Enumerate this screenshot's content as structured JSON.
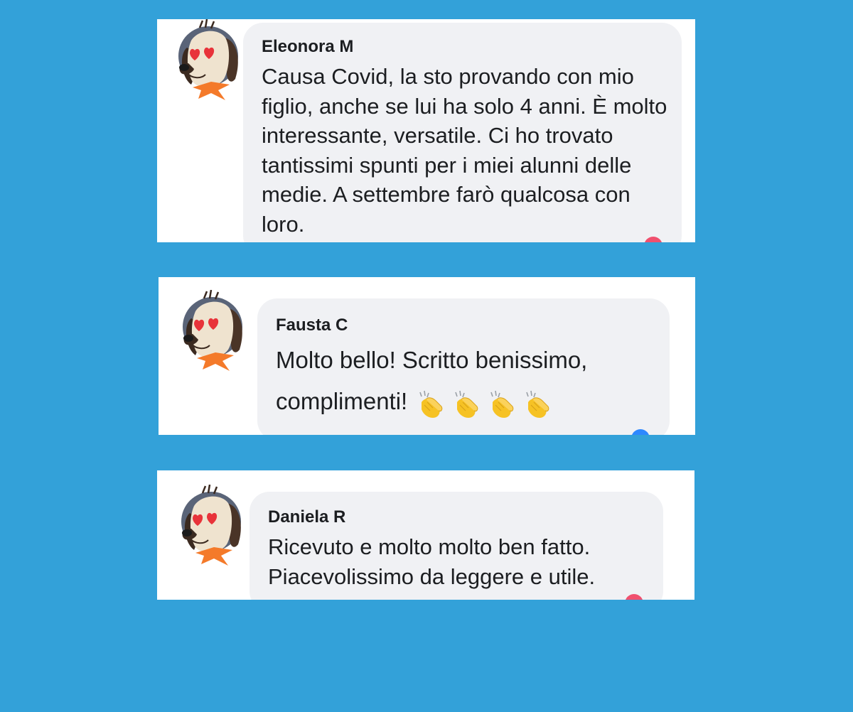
{
  "comments": [
    {
      "author": "Eleonora M",
      "text": "Causa Covid, la sto provando con mio figlio, anche se lui ha solo 4 anni. È molto interessante, versatile. Ci ho trovato tantissimi spunti per i miei alunni delle medie. A settembre farò qualcosa con loro.",
      "avatar_icon": "dog-heart-eyes-icon",
      "reaction_color": "#f0506e"
    },
    {
      "author": "Fausta C",
      "text": "Molto bello! Scritto benissimo, complimenti!",
      "emoji_icons": [
        "clapping-hands-icon",
        "clapping-hands-icon",
        "clapping-hands-icon",
        "clapping-hands-icon"
      ],
      "avatar_icon": "dog-heart-eyes-icon",
      "reaction_color": "#2d88ff"
    },
    {
      "author": "Daniela R",
      "text": "Ricevuto e molto molto ben fatto. Piacevolissimo da leggere e utile.",
      "avatar_icon": "dog-heart-eyes-icon",
      "reaction_color": "#f0506e"
    }
  ],
  "colors": {
    "background": "#33a1d9",
    "card": "#ffffff",
    "bubble": "#f0f1f4",
    "text": "#1c1e21"
  }
}
